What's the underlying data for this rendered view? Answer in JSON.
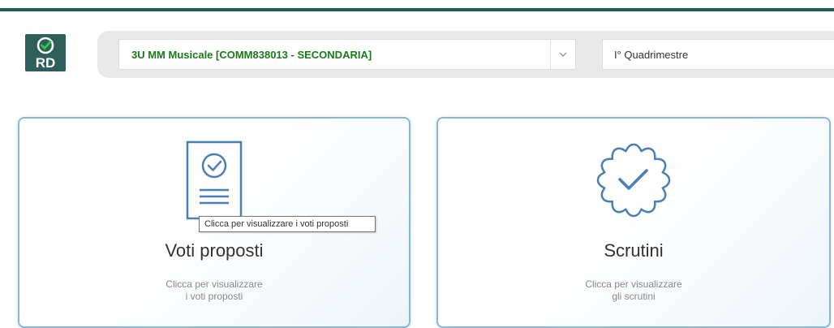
{
  "logo": {
    "mark": "RD"
  },
  "selector": {
    "class_value": "3U MM Musicale [COMM838013 - SECONDARIA]",
    "period_value": "I° Quadrimestre"
  },
  "cards": {
    "voti": {
      "title": "Voti proposti",
      "desc_line1": "Clicca per visualizzare",
      "desc_line2": "i voti proposti"
    },
    "scrutini": {
      "title": "Scrutini",
      "desc_line1": "Clicca per visualizzare",
      "desc_line2": "gli scrutini"
    }
  },
  "tooltip": {
    "text": "Clicca per visualizzare i voti proposti"
  },
  "colors": {
    "brand": "#1f5a57",
    "accent_blue": "#4a7fb5",
    "class_text": "#1a7a1a",
    "check_green": "#2ecc40"
  },
  "icons": [
    "logo-check-icon",
    "chevron-down-icon",
    "document-check-icon",
    "badge-check-icon"
  ]
}
